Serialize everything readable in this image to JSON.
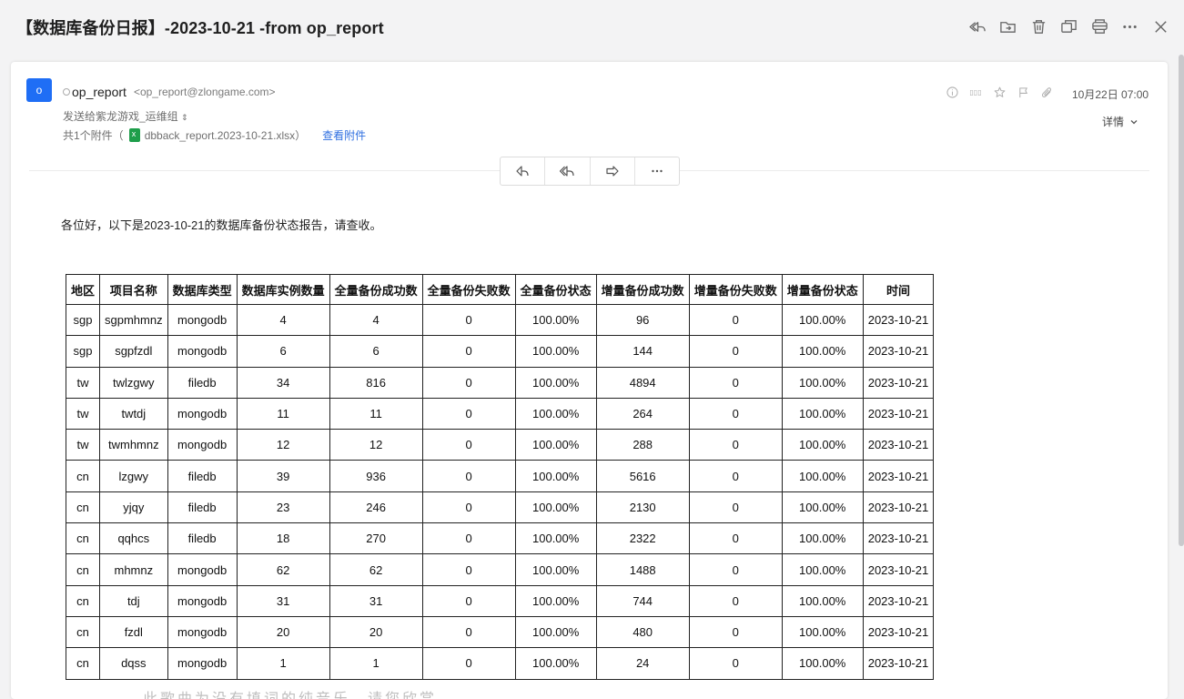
{
  "header": {
    "subject": "【数据库备份日报】-2023-10-21 -from op_report",
    "icons": [
      "reply-all-icon",
      "move-to-folder-icon",
      "delete-icon",
      "new-window-icon",
      "print-icon",
      "more-icon",
      "close-icon"
    ]
  },
  "email": {
    "avatar_letter": "o",
    "sender_name": "op_report",
    "sender_email": "<op_report@zlongame.com>",
    "recipients": "发送给紫龙游戏_运维组",
    "attachment_prefix": "共1个附件（",
    "attachment_name": "dbback_report.2023-10-21.xlsx",
    "attachment_suffix": "）",
    "view_attachment": "查看附件",
    "date": "10月22日 07:00",
    "details_label": "详情",
    "dots_label": "▯▯▯"
  },
  "actions": [
    "reply-icon",
    "reply-all-icon",
    "forward-icon",
    "more-icon"
  ],
  "body": {
    "greeting": "各位好，以下是2023-10-21的数据库备份状态报告，请查收。",
    "watermark": "此歌曲为没有填词的纯音乐，请您欣赏"
  },
  "table": {
    "headers": [
      "地区",
      "项目名称",
      "数据库类型",
      "数据库实例数量",
      "全量备份成功数",
      "全量备份失败数",
      "全量备份状态",
      "增量备份成功数",
      "增量备份失败数",
      "增量备份状态",
      "时间"
    ],
    "rows": [
      [
        "sgp",
        "sgpmhmnz",
        "mongodb",
        "4",
        "4",
        "0",
        "100.00%",
        "96",
        "0",
        "100.00%",
        "2023-10-21"
      ],
      [
        "sgp",
        "sgpfzdl",
        "mongodb",
        "6",
        "6",
        "0",
        "100.00%",
        "144",
        "0",
        "100.00%",
        "2023-10-21"
      ],
      [
        "tw",
        "twlzgwy",
        "filedb",
        "34",
        "816",
        "0",
        "100.00%",
        "4894",
        "0",
        "100.00%",
        "2023-10-21"
      ],
      [
        "tw",
        "twtdj",
        "mongodb",
        "11",
        "11",
        "0",
        "100.00%",
        "264",
        "0",
        "100.00%",
        "2023-10-21"
      ],
      [
        "tw",
        "twmhmnz",
        "mongodb",
        "12",
        "12",
        "0",
        "100.00%",
        "288",
        "0",
        "100.00%",
        "2023-10-21"
      ],
      [
        "cn",
        "lzgwy",
        "filedb",
        "39",
        "936",
        "0",
        "100.00%",
        "5616",
        "0",
        "100.00%",
        "2023-10-21"
      ],
      [
        "cn",
        "yjqy",
        "filedb",
        "23",
        "246",
        "0",
        "100.00%",
        "2130",
        "0",
        "100.00%",
        "2023-10-21"
      ],
      [
        "cn",
        "qqhcs",
        "filedb",
        "18",
        "270",
        "0",
        "100.00%",
        "2322",
        "0",
        "100.00%",
        "2023-10-21"
      ],
      [
        "cn",
        "mhmnz",
        "mongodb",
        "62",
        "62",
        "0",
        "100.00%",
        "1488",
        "0",
        "100.00%",
        "2023-10-21"
      ],
      [
        "cn",
        "tdj",
        "mongodb",
        "31",
        "31",
        "0",
        "100.00%",
        "744",
        "0",
        "100.00%",
        "2023-10-21"
      ],
      [
        "cn",
        "fzdl",
        "mongodb",
        "20",
        "20",
        "0",
        "100.00%",
        "480",
        "0",
        "100.00%",
        "2023-10-21"
      ],
      [
        "cn",
        "dqss",
        "mongodb",
        "1",
        "1",
        "0",
        "100.00%",
        "24",
        "0",
        "100.00%",
        "2023-10-21"
      ]
    ]
  }
}
